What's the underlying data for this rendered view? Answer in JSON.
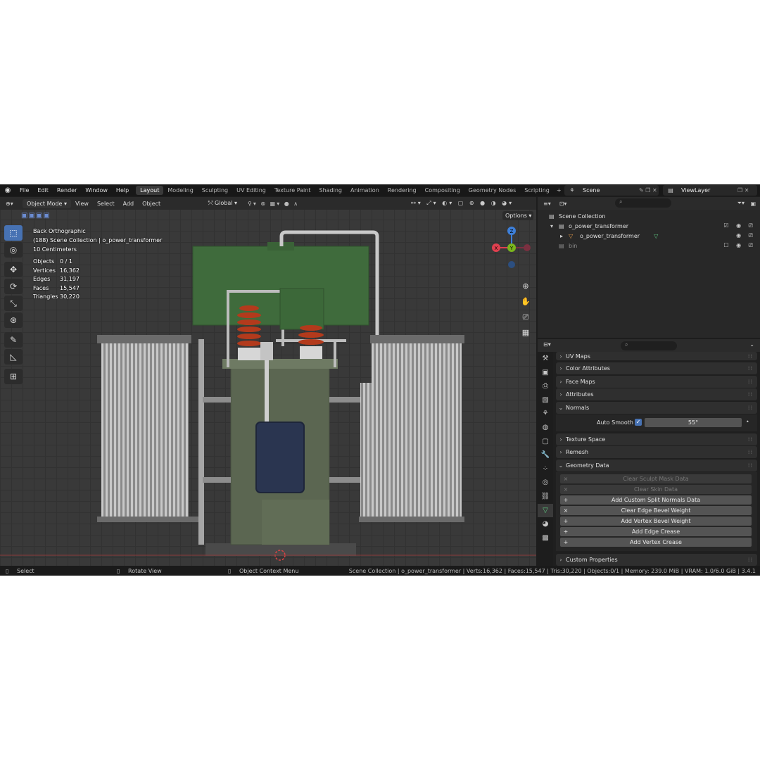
{
  "menu": [
    "File",
    "Edit",
    "Render",
    "Window",
    "Help"
  ],
  "workspaces": [
    "Layout",
    "Modeling",
    "Sculpting",
    "UV Editing",
    "Texture Paint",
    "Shading",
    "Animation",
    "Rendering",
    "Compositing",
    "Geometry Nodes",
    "Scripting"
  ],
  "active_workspace": "Layout",
  "scene": "Scene",
  "view_layer": "ViewLayer",
  "viewport": {
    "mode": "Object Mode",
    "menus": [
      "View",
      "Select",
      "Add",
      "Object"
    ],
    "orientation": "Global",
    "options": "Options",
    "view_name": "Back Orthographic",
    "collection_line": "(188) Scene Collection | o_power_transformer",
    "scale": "10 Centimeters",
    "stats": [
      {
        "k": "Objects",
        "v": "0 / 1"
      },
      {
        "k": "Vertices",
        "v": "16,362"
      },
      {
        "k": "Edges",
        "v": "31,197"
      },
      {
        "k": "Faces",
        "v": "15,547"
      },
      {
        "k": "Triangles",
        "v": "30,220"
      }
    ],
    "gizmo_labels": {
      "z": "Z",
      "y": "Y",
      "x": "X"
    }
  },
  "outliner": {
    "root": "Scene Collection",
    "collection": "o_power_transformer",
    "object": "o_power_transformer",
    "bin": "bin"
  },
  "properties": {
    "panels": [
      "UV Maps",
      "Color Attributes",
      "Face Maps",
      "Attributes",
      "Normals",
      "Texture Space",
      "Remesh",
      "Geometry Data",
      "Custom Properties"
    ],
    "auto_smooth_label": "Auto Smooth",
    "auto_smooth_angle": "55°",
    "geometry_buttons": [
      {
        "label": "Clear Sculpt Mask Data",
        "icon": "×",
        "enabled": false
      },
      {
        "label": "Clear Skin Data",
        "icon": "×",
        "enabled": false
      },
      {
        "label": "Add Custom Split Normals Data",
        "icon": "+",
        "enabled": true
      },
      {
        "label": "Clear Edge Bevel Weight",
        "icon": "×",
        "enabled": true
      },
      {
        "label": "Add Vertex Bevel Weight",
        "icon": "+",
        "enabled": true
      },
      {
        "label": "Add Edge Crease",
        "icon": "+",
        "enabled": true
      },
      {
        "label": "Add Vertex Crease",
        "icon": "+",
        "enabled": true
      }
    ]
  },
  "status": {
    "select": "Select",
    "rotate": "Rotate View",
    "context": "Object Context Menu",
    "info": "Scene Collection | o_power_transformer | Verts:16,362 | Faces:15,547 | Tris:30,220 | Objects:0/1 | Memory: 239.0 MiB | VRAM: 1.0/6.0 GiB | 3.4.1"
  },
  "colors": {
    "accent": "#4772b3",
    "tank_green": "#3f6b3c",
    "body_green": "#5a6a4e",
    "bushing_red": "#b33a1c",
    "x_axis": "#e0404f",
    "y_axis": "#7ab51d",
    "z_axis": "#3d7fd9"
  }
}
